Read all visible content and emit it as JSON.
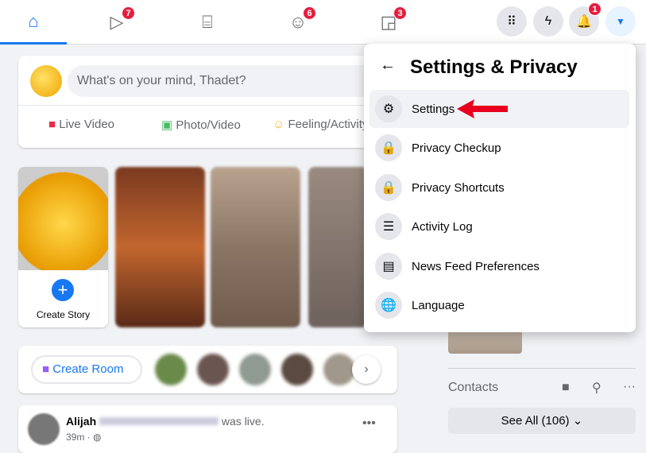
{
  "nav": {
    "tabs": [
      {
        "name": "home",
        "icon": "home-icon"
      },
      {
        "name": "watch",
        "icon": "video-icon",
        "badge": "7"
      },
      {
        "name": "marketplace",
        "icon": "store-icon"
      },
      {
        "name": "groups",
        "icon": "groups-icon",
        "badge": "6"
      },
      {
        "name": "gaming",
        "icon": "gaming-icon",
        "badge": "3"
      }
    ],
    "notifications_badge": "1"
  },
  "composer": {
    "placeholder": "What's on your mind, Thadet?",
    "actions": [
      "Live Video",
      "Photo/Video",
      "Feeling/Activity"
    ]
  },
  "stories": {
    "create_label": "Create Story"
  },
  "rooms": {
    "create_label": "Create Room"
  },
  "post": {
    "author": "Alijah",
    "suffix": "was live.",
    "time": "39m ·"
  },
  "menu": {
    "title": "Settings & Privacy",
    "items": [
      {
        "label": "Settings",
        "icon": "gear-icon"
      },
      {
        "label": "Privacy Checkup",
        "icon": "lock-heart-icon"
      },
      {
        "label": "Privacy Shortcuts",
        "icon": "lock-icon"
      },
      {
        "label": "Activity Log",
        "icon": "list-icon"
      },
      {
        "label": "News Feed Preferences",
        "icon": "feed-icon"
      },
      {
        "label": "Language",
        "icon": "globe-icon"
      }
    ]
  },
  "contacts": {
    "title": "Contacts",
    "see_all": "See All (106)"
  },
  "colors": {
    "accent": "#1877f2",
    "badge": "#e41e3f",
    "arrow": "#e8001c"
  }
}
